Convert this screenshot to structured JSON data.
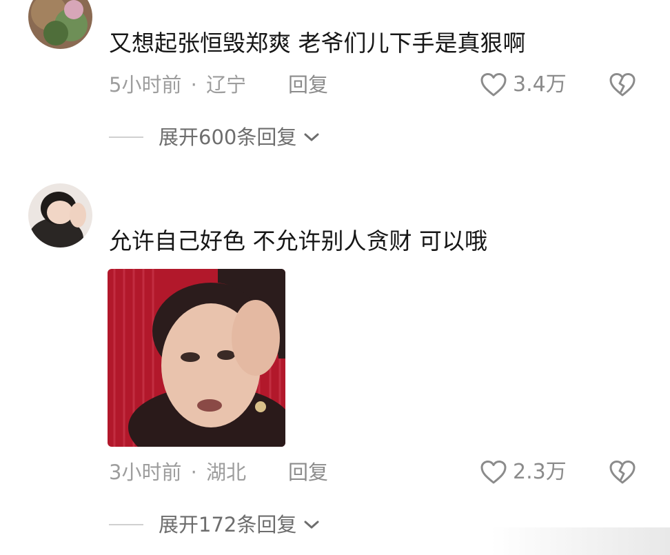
{
  "comments": [
    {
      "username": "",
      "text": "又想起张恒毁郑爽 老爷们儿下手是真狠啊",
      "time": "5小时前",
      "sep": "·",
      "location": "辽宁",
      "reply_label": "回复",
      "likes": "3.4万",
      "expand_label": "展开600条回复"
    },
    {
      "username": "",
      "text": "允许自己好色 不允许别人贪财 可以哦",
      "time": "3小时前",
      "sep": "·",
      "location": "湖北",
      "reply_label": "回复",
      "likes": "2.3万",
      "expand_label": "展开172条回复"
    }
  ],
  "icons": {
    "like": "heart-outline-icon",
    "dislike": "broken-heart-icon",
    "expand": "chevron-down-icon"
  },
  "colors": {
    "text": "#161616",
    "meta": "#9d9d9d",
    "sticker_bg": "#b2182b"
  }
}
